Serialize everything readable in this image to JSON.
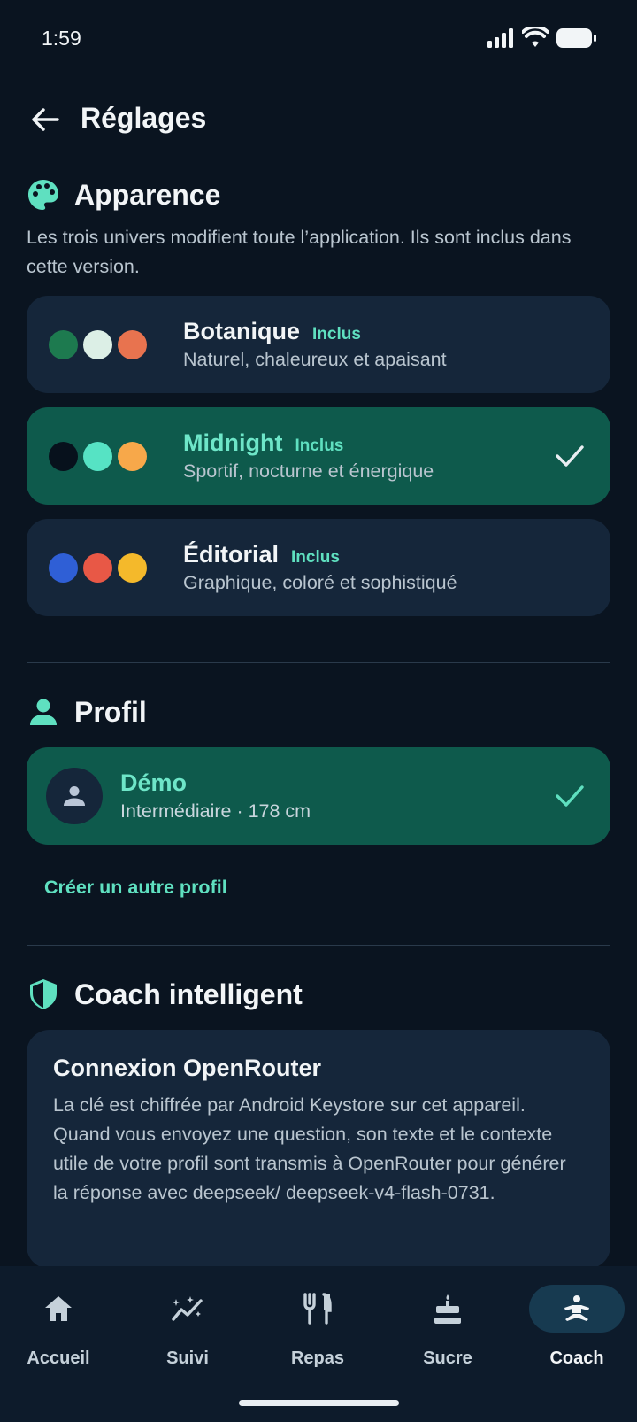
{
  "status": {
    "time": "1:59"
  },
  "header": {
    "title": "Réglages"
  },
  "appearance": {
    "title": "Apparence",
    "description": "Les trois univers modifient toute l’application. Ils sont inclus dans cette version.",
    "themes": [
      {
        "name": "Botanique",
        "badge": "Inclus",
        "subtitle": "Naturel, chaleureux et apaisant",
        "colors": [
          "#1d7a4f",
          "#dcefe6",
          "#e8734f"
        ],
        "selected": false
      },
      {
        "name": "Midnight",
        "badge": "Inclus",
        "subtitle": "Sportif, nocturne et énergique",
        "colors": [
          "#07111c",
          "#56e3c4",
          "#f7a84a"
        ],
        "selected": true
      },
      {
        "name": "Éditorial",
        "badge": "Inclus",
        "subtitle": "Graphique, coloré et sophistiqué",
        "colors": [
          "#2f5fd6",
          "#e85846",
          "#f4b92b"
        ],
        "selected": false
      }
    ]
  },
  "profile": {
    "title": "Profil",
    "name": "Démo",
    "subtitle": "Intermédiaire · 178 cm",
    "create_label": "Créer un autre profil"
  },
  "coach": {
    "title": "Coach intelligent",
    "card_title": "Connexion OpenRouter",
    "card_text": "La clé est chiffrée par Android Keystore sur cet appareil. Quand vous envoyez une question, son texte et le contexte utile de votre profil sont transmis à OpenRouter pour générer la réponse avec deepseek/ deepseek-v4-flash-0731."
  },
  "nav": {
    "items": [
      {
        "label": "Accueil",
        "icon": "home-icon",
        "active": false
      },
      {
        "label": "Suivi",
        "icon": "trend-icon",
        "active": false
      },
      {
        "label": "Repas",
        "icon": "utensils-icon",
        "active": false
      },
      {
        "label": "Sucre",
        "icon": "cake-icon",
        "active": false
      },
      {
        "label": "Coach",
        "icon": "yoga-icon",
        "active": true
      }
    ]
  },
  "colors": {
    "accent": "#5fe0c0",
    "background": "#0a1420",
    "card": "#15263a",
    "selected_card": "#0e5a4c"
  }
}
